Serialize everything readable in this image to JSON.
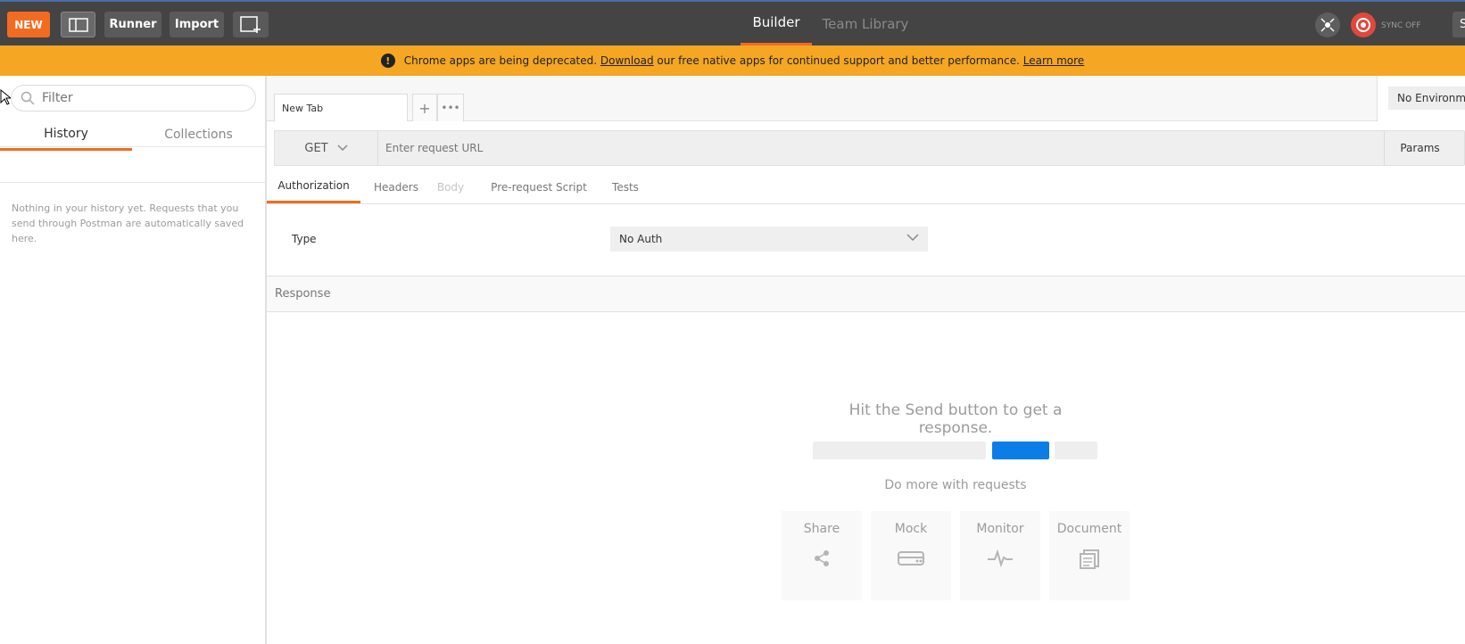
{
  "topbar": {
    "new_label": "NEW",
    "runner_label": "Runner",
    "import_label": "Import",
    "nav_builder": "Builder",
    "nav_team_library": "Team Library",
    "sync_label": "SYNC OFF",
    "sign_in_partial": "S"
  },
  "banner": {
    "prefix": "Chrome apps are being deprecated.",
    "download_link": "Download",
    "middle": "our free native apps for continued support and better performance.",
    "learn_more_link": "Learn more"
  },
  "sidebar": {
    "filter_placeholder": "Filter",
    "tabs": [
      {
        "label": "History",
        "active": true
      },
      {
        "label": "Collections",
        "active": false
      }
    ],
    "empty_message": "Nothing in your history yet. Requests that you send through Postman are automatically saved here."
  },
  "request": {
    "tab_label": "New Tab",
    "add_tab": "+",
    "more_tabs": "•••",
    "environment": "No Environment",
    "method": "GET",
    "url_placeholder": "Enter request URL",
    "params_label": "Params",
    "subtabs": [
      {
        "label": "Authorization",
        "active": true
      },
      {
        "label": "Headers",
        "active": false
      },
      {
        "label": "Body",
        "active": false
      },
      {
        "label": "Pre-request Script",
        "active": false
      },
      {
        "label": "Tests",
        "active": false
      }
    ],
    "type_label": "Type",
    "auth_value": "No Auth"
  },
  "response": {
    "header": "Response",
    "hint": "Hit the Send button to get a response.",
    "do_more": "Do more with requests",
    "cards": [
      {
        "label": "Share",
        "icon": "share-icon"
      },
      {
        "label": "Mock",
        "icon": "mock-server-icon"
      },
      {
        "label": "Monitor",
        "icon": "monitor-pulse-icon"
      },
      {
        "label": "Document",
        "icon": "document-icon"
      }
    ]
  },
  "colors": {
    "accent": "#f26b21",
    "topbar": "#444444",
    "banner": "#f5a623",
    "send_blue": "#0a7ee6"
  }
}
